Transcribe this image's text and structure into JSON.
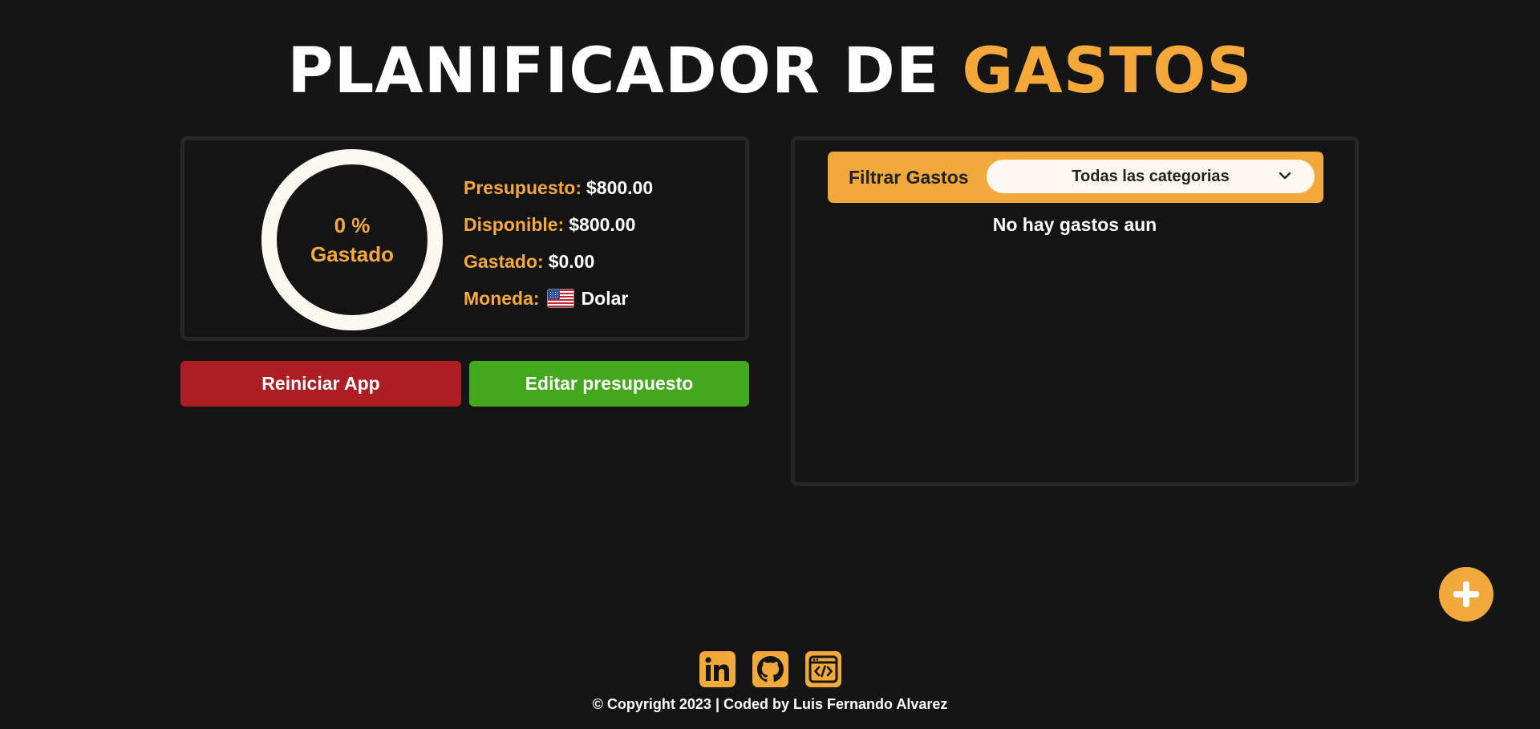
{
  "header": {
    "title_part1": "PLANIFICADOR DE ",
    "title_part2": "GASTOS"
  },
  "budget": {
    "percent_spent": 0,
    "percent_label": "0 %",
    "spent_caption": "Gastado",
    "presupuesto_label": "Presupuesto:",
    "presupuesto_value": "$800.00",
    "disponible_label": "Disponible:",
    "disponible_value": "$800.00",
    "gastado_label": "Gastado:",
    "gastado_value": "$0.00",
    "moneda_label": "Moneda:",
    "moneda_value": "Dolar",
    "moneda_flag_icon": "us-flag-icon"
  },
  "actions": {
    "reset_label": "Reiniciar App",
    "edit_label": "Editar presupuesto"
  },
  "expenses": {
    "filter_label": "Filtrar Gastos",
    "filter_selected": "Todas las categorias",
    "empty_message": "No hay gastos aun"
  },
  "fab": {
    "icon": "plus-icon"
  },
  "footer": {
    "social_icons": [
      "linkedin-icon",
      "github-icon",
      "code-portfolio-icon"
    ],
    "copyright": "© Copyright 2023 | Coded by Luis Fernando Alvarez"
  },
  "colors": {
    "background": "#151515",
    "accent": "#f2a93b",
    "danger": "#ad1e24",
    "success": "#43a81c",
    "ring": "#fbf8f0"
  }
}
